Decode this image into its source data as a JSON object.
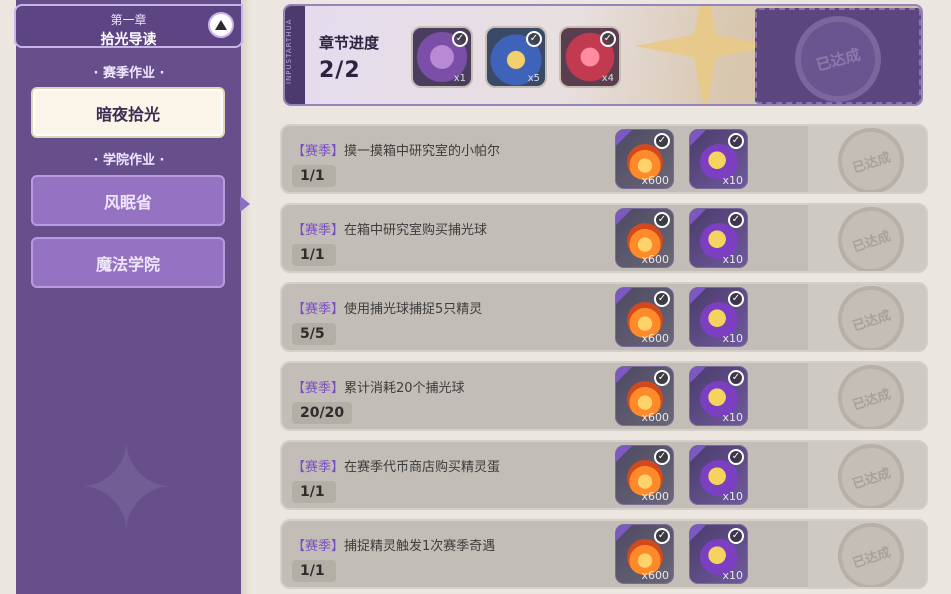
{
  "chapter": {
    "subtitle": "第一章",
    "title": "拾光导读"
  },
  "sidebar": {
    "season_section": "· 赛季作业 ·",
    "academy_section": "· 学院作业 ·",
    "items": [
      {
        "label": "暗夜拾光",
        "active": true
      },
      {
        "label": "风眠省",
        "active": false
      },
      {
        "label": "魔法学院",
        "active": false
      }
    ]
  },
  "progress_banner": {
    "side_text": "INPUSTARTHUA",
    "label": "章节进度",
    "value": "2/2",
    "rewards": [
      {
        "icon": "purple-orb-icon",
        "qty": "x1",
        "color": "#7b4fa8"
      },
      {
        "icon": "blue-fan-icon",
        "qty": "x5",
        "color": "#3f63b8"
      },
      {
        "icon": "red-candy-icon",
        "qty": "x4",
        "color": "#c23a4f"
      }
    ],
    "stamp": "已达成"
  },
  "tasks": [
    {
      "tag": "【赛季】",
      "text": "摸一摸箱中研究室的小帕尔",
      "progress": "1/1",
      "reward1_qty": "x600",
      "reward2_qty": "x10",
      "stamp": "已达成"
    },
    {
      "tag": "【赛季】",
      "text": "在箱中研究室购买捕光球",
      "progress": "1/1",
      "reward1_qty": "x600",
      "reward2_qty": "x10",
      "stamp": "已达成"
    },
    {
      "tag": "【赛季】",
      "text": "使用捕光球捕捉5只精灵",
      "progress": "5/5",
      "reward1_qty": "x600",
      "reward2_qty": "x10",
      "stamp": "已达成"
    },
    {
      "tag": "【赛季】",
      "text": "累计消耗20个捕光球",
      "progress": "20/20",
      "reward1_qty": "x600",
      "reward2_qty": "x10",
      "stamp": "已达成"
    },
    {
      "tag": "【赛季】",
      "text": "在赛季代币商店购买精灵蛋",
      "progress": "1/1",
      "reward1_qty": "x600",
      "reward2_qty": "x10",
      "stamp": "已达成"
    },
    {
      "tag": "【赛季】",
      "text": "捕捉精灵触发1次赛季奇遇",
      "progress": "1/1",
      "reward1_qty": "x600",
      "reward2_qty": "x10",
      "stamp": "已达成"
    }
  ],
  "check_mark": "✓"
}
